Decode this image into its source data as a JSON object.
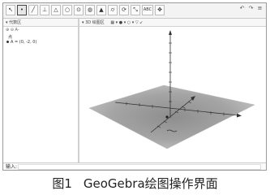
{
  "toolbar": {
    "tools": [
      {
        "name": "move-tool",
        "glyph": "↖"
      },
      {
        "name": "point-tool",
        "glyph": "•"
      },
      {
        "name": "line-tool",
        "glyph": "╱"
      },
      {
        "name": "perpendicular-tool",
        "glyph": "⊥"
      },
      {
        "name": "polygon-tool",
        "glyph": "△"
      },
      {
        "name": "circle-tool",
        "glyph": "○"
      },
      {
        "name": "intersect-tool",
        "glyph": "⊙"
      },
      {
        "name": "sphere-tool",
        "glyph": "◍"
      },
      {
        "name": "pyramid-tool",
        "glyph": "▲"
      },
      {
        "name": "cylinder-tool",
        "glyph": "⌭"
      },
      {
        "name": "rotate-tool",
        "glyph": "⟳"
      },
      {
        "name": "reflect-tool",
        "glyph": "⤡"
      },
      {
        "name": "text-tool",
        "glyph": "ABC"
      },
      {
        "name": "rotate-view-tool",
        "glyph": "✥"
      }
    ],
    "window_controls": [
      "↶",
      "↷",
      "≡"
    ]
  },
  "algebra": {
    "header": "▾ 代数区",
    "header_icons": "⊕ ⊖ A-",
    "section": "点",
    "items": [
      {
        "label": "A = (0, -2, 0)"
      }
    ]
  },
  "view3d": {
    "header": "▾ 3D 绘图区",
    "header_tools": "▦ ▾  ● ▾  ○ ▾  ▽  ↙"
  },
  "inputbar": {
    "label": "输入:"
  },
  "caption": {
    "figure": "图1",
    "text": "GeoGebra绘图操作界面"
  }
}
